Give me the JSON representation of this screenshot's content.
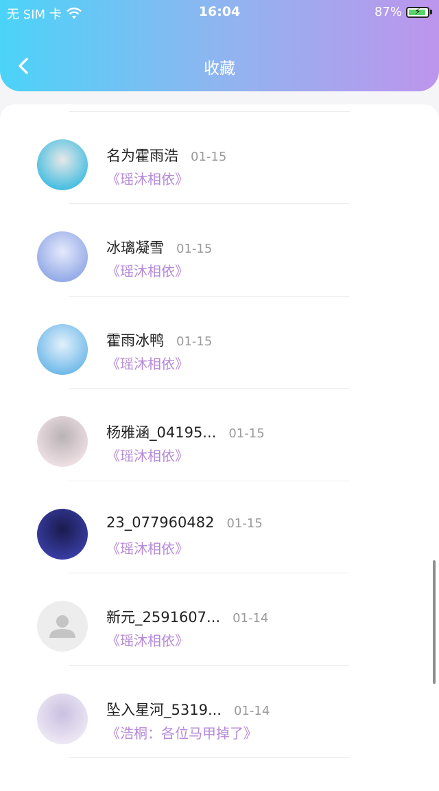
{
  "status_bar": {
    "carrier": "无 SIM 卡",
    "time": "16:04",
    "battery": "87%"
  },
  "nav": {
    "title": "收藏",
    "back_icon": "chevron-left-icon"
  },
  "items": [
    {
      "name": "",
      "date": "",
      "work": "",
      "avatar_colors": [
        "#6c7ad0",
        "#c9d2f5"
      ]
    },
    {
      "name": "名为霍雨浩",
      "date": "01-15",
      "work": "《瑶沐相依》",
      "avatar_colors": [
        "#3bbbe0",
        "#e8e8e8"
      ]
    },
    {
      "name": "冰璃凝雪",
      "date": "01-15",
      "work": "《瑶沐相依》",
      "avatar_colors": [
        "#8da6e6",
        "#e6e9fb"
      ]
    },
    {
      "name": "霍雨冰鸭",
      "date": "01-15",
      "work": "《瑶沐相依》",
      "avatar_colors": [
        "#69b6e8",
        "#e3f1fb"
      ]
    },
    {
      "name": "杨雅涵_04195...",
      "date": "01-15",
      "work": "《瑶沐相依》",
      "avatar_colors": [
        "#f1e2e6",
        "#b9b2b5"
      ]
    },
    {
      "name": "23_077960482",
      "date": "01-15",
      "work": "《瑶沐相依》",
      "avatar_colors": [
        "#3a3fa8",
        "#1a1b4d"
      ]
    },
    {
      "name": "新元_2591607...",
      "date": "01-14",
      "work": "《瑶沐相依》",
      "avatar_colors": [
        "#ededed",
        "#c4c4c4"
      ]
    },
    {
      "name": "坠入星河_5319...",
      "date": "01-14",
      "work": "《浩桐：各位马甲掉了》",
      "avatar_colors": [
        "#efeaf6",
        "#c9c0e0"
      ]
    }
  ]
}
